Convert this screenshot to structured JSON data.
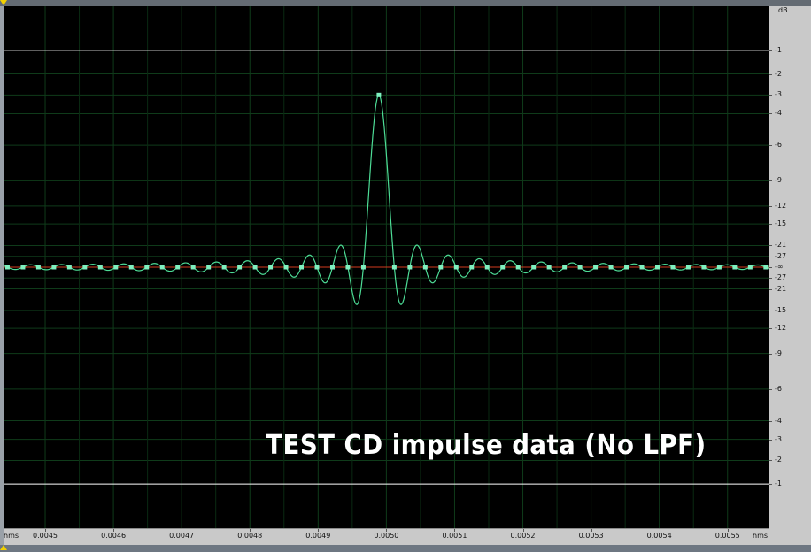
{
  "overlay": {
    "title": "TEST CD impulse data (No LPF)"
  },
  "axes": {
    "y_unit": "dB",
    "y_labels_top": [
      "-1",
      "-2",
      "-3",
      "-4",
      "-6",
      "-9",
      "-12",
      "-15",
      "-21",
      "-27"
    ],
    "y_center": "-∞",
    "y_labels_bottom": [
      "-27",
      "-21",
      "-15",
      "-12",
      "-9",
      "-6",
      "-4",
      "-3",
      "-2",
      "-1"
    ],
    "x_unit_left": "hms",
    "x_unit_right": "hms",
    "x_labels": [
      "0.0045",
      "0.0046",
      "0.0047",
      "0.0048",
      "0.0049",
      "0.0050",
      "0.0051",
      "0.0052",
      "0.0053",
      "0.0054",
      "0.0055"
    ]
  },
  "chart_data": {
    "type": "line",
    "x_unit": "s",
    "x_range": [
      0.004439,
      0.00556
    ],
    "y_scale": "dB-symmetric",
    "series": [
      {
        "sample_interval": 2.26757e-05,
        "peak_time": 0.004989,
        "peak_db": -3,
        "sample_values": [
          0,
          0,
          0,
          0,
          0,
          0,
          0,
          0,
          0,
          0,
          0,
          0,
          0,
          0,
          0,
          0,
          0,
          0,
          0,
          0,
          0,
          0,
          0,
          0,
          -3,
          0,
          0,
          0,
          0,
          0,
          0,
          0,
          0,
          0,
          0,
          0,
          0,
          0,
          0,
          0,
          0,
          0,
          0,
          0,
          0,
          0,
          0,
          0,
          0,
          0
        ],
        "reconstructed_min_db": -15
      }
    ],
    "reference_lines_db": [
      -1,
      -1
    ],
    "grid": true,
    "colors": {
      "waveform": "#4ddc96",
      "samples": "#7ff0c0",
      "center_line": "#d23a1e",
      "grid": "#0f3b1a",
      "reference": "#ffffff"
    }
  }
}
